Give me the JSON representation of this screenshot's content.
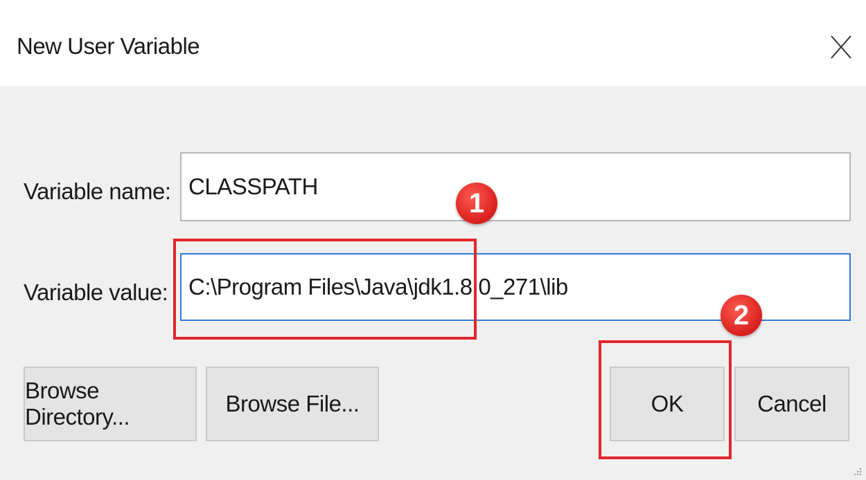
{
  "dialog": {
    "title": "New User Variable",
    "close_icon": "close-icon"
  },
  "form": {
    "name_label": "Variable name:",
    "name_value": "CLASSPATH",
    "value_label": "Variable value:",
    "value_value": "C:\\Program Files\\Java\\jdk1.8.0_271\\lib"
  },
  "buttons": {
    "browse_directory": "Browse Directory...",
    "browse_file": "Browse File...",
    "ok": "OK",
    "cancel": "Cancel"
  },
  "annotations": {
    "step1": "1",
    "step2": "2",
    "highlight_color": "#e0262b"
  }
}
